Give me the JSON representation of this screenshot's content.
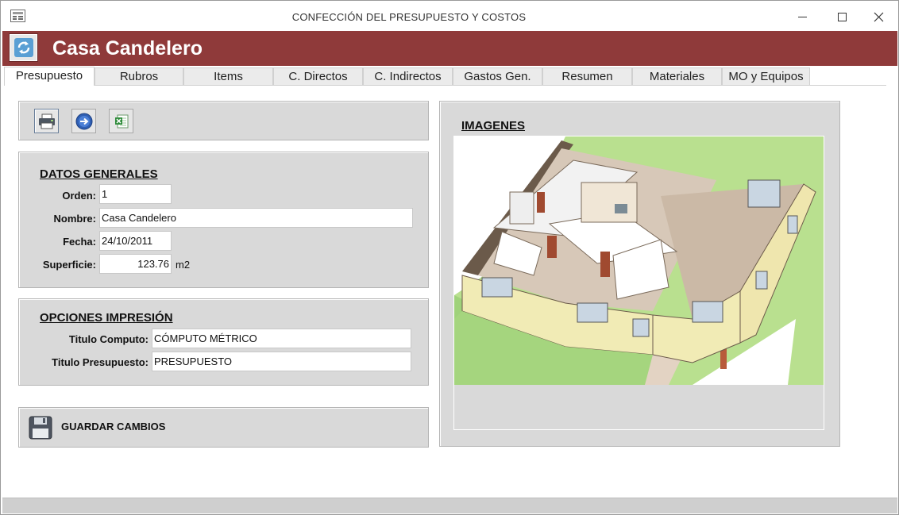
{
  "window": {
    "title": "CONFECCIÓN DEL PRESUPUESTO Y COSTOS",
    "icon": "form-icon",
    "controls": [
      "minimize-icon",
      "maximize-icon",
      "close-icon"
    ]
  },
  "header": {
    "title": "Casa Candelero",
    "refresh_icon": "refresh-icon",
    "background_color": "#8f3a3a"
  },
  "tabs": [
    {
      "label": "Presupuesto",
      "active": true
    },
    {
      "label": "Rubros",
      "active": false
    },
    {
      "label": "Items",
      "active": false
    },
    {
      "label": "C. Directos",
      "active": false
    },
    {
      "label": "C. Indirectos",
      "active": false
    },
    {
      "label": "Gastos Gen.",
      "active": false
    },
    {
      "label": "Resumen",
      "active": false
    },
    {
      "label": "Materiales",
      "active": false
    },
    {
      "label": "MO y Equipos",
      "active": false
    }
  ],
  "toolbar": {
    "buttons": [
      {
        "icon": "printer-icon"
      },
      {
        "icon": "arrow-right-icon"
      },
      {
        "icon": "excel-icon"
      }
    ]
  },
  "datos_generales": {
    "title": "DATOS GENERALES",
    "orden_label": "Orden:",
    "orden_value": "1",
    "nombre_label": "Nombre:",
    "nombre_value": "Casa Candelero",
    "fecha_label": "Fecha:",
    "fecha_value": "24/10/2011",
    "superficie_label": "Superficie:",
    "superficie_value": "123.76",
    "superficie_unit": "m2"
  },
  "opciones_impresion": {
    "title": "OPCIONES IMPRESIÓN",
    "titulo_computo_label": "Titulo Computo:",
    "titulo_computo_value": "CÓMPUTO MÉTRICO",
    "titulo_presupuesto_label": "Titulo Presupuesto:",
    "titulo_presupuesto_value": "PRESUPUESTO"
  },
  "save": {
    "label": "GUARDAR CAMBIOS",
    "icon": "floppy-disk-icon"
  },
  "imagenes": {
    "title": "IMAGENES"
  }
}
